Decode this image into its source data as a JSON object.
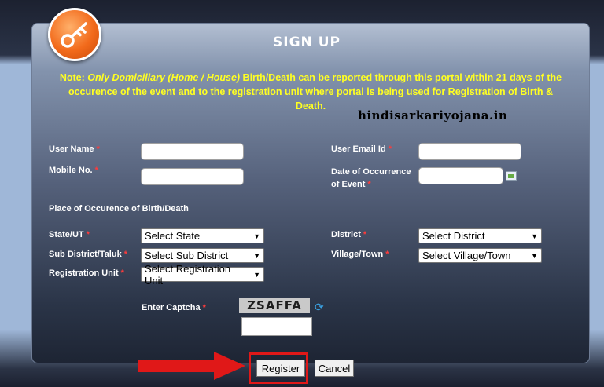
{
  "header": {
    "title": "SIGN UP",
    "logo_icon": "key-icon"
  },
  "note": {
    "prefix": "Note: ",
    "emphasis": "Only Domiciliary (Home / House)",
    "body": " Birth/Death can be reported through this portal within 21 days of the occurence of the event and to the registration unit where portal is being used for Registration of Birth & Death."
  },
  "watermark": "hindisarkariyojana.in",
  "form": {
    "user_name_label": "User Name",
    "mobile_label": "Mobile No.",
    "email_label": "User Email Id",
    "date_label_1": "Date of Occurrence",
    "date_label_2": "of Event",
    "required_mark": "*",
    "section_label": "Place of Occurence of Birth/Death",
    "state_label": "State/UT",
    "district_label": "District",
    "subdistrict_label": "Sub District/Taluk",
    "village_label": "Village/Town",
    "reg_unit_label": "Registration Unit",
    "state_value": "Select State",
    "district_value": "Select District",
    "subdistrict_value": "Select Sub District",
    "village_value": "Select Village/Town",
    "reg_unit_value": "Select Registration Unit",
    "captcha_label": "Enter Captcha",
    "captcha_text": "ZSAFFA"
  },
  "buttons": {
    "register": "Register",
    "cancel": "Cancel"
  },
  "colors": {
    "note": "#ffff22",
    "required": "#ff3b3b",
    "highlight": "#e01818",
    "logo": "#f26a1b"
  }
}
